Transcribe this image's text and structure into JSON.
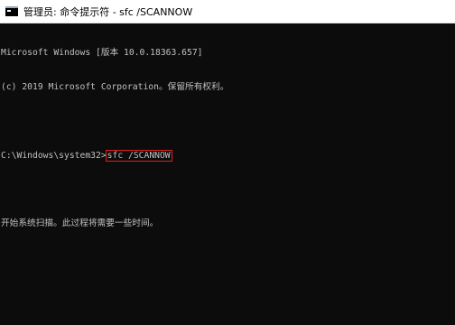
{
  "window": {
    "title": "管理员: 命令提示符 - sfc  /SCANNOW"
  },
  "console": {
    "line1": "Microsoft Windows [版本 10.0.18363.657]",
    "line2": "(c) 2019 Microsoft Corporation。保留所有权利。",
    "prompt": "C:\\Windows\\system32>",
    "command": "sfc /SCANNOW",
    "output": "开始系统扫描。此过程将需要一些时间。"
  },
  "colors": {
    "background": "#0c0c0c",
    "text": "#c0c0c0",
    "highlight": "#e02020"
  }
}
